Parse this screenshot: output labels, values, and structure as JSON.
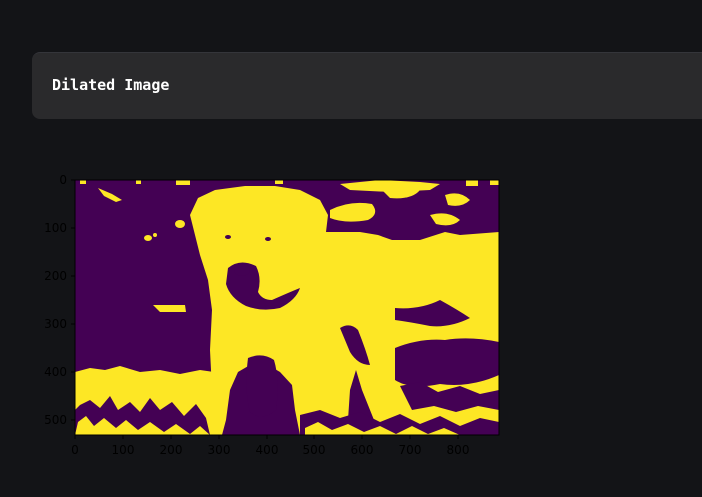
{
  "header": {
    "title": "Dilated Image"
  },
  "figure": {
    "colors": {
      "background": "#440154",
      "foreground": "#fde725",
      "axis": "#000000",
      "tick_text": "#000000"
    },
    "x_ticks": [
      "0",
      "100",
      "200",
      "300",
      "400",
      "500",
      "600",
      "700",
      "800"
    ],
    "y_ticks": [
      "0",
      "100",
      "200",
      "300",
      "400",
      "500"
    ]
  },
  "chart_data": {
    "type": "heatmap",
    "title": "",
    "xlabel": "",
    "ylabel": "",
    "xlim": [
      0,
      886
    ],
    "ylim": [
      535,
      0
    ],
    "colormap": "viridis (binary)",
    "x_ticks": [
      0,
      100,
      200,
      300,
      400,
      500,
      600,
      700,
      800
    ],
    "y_ticks": [
      0,
      100,
      200,
      300,
      400,
      500
    ]
  }
}
